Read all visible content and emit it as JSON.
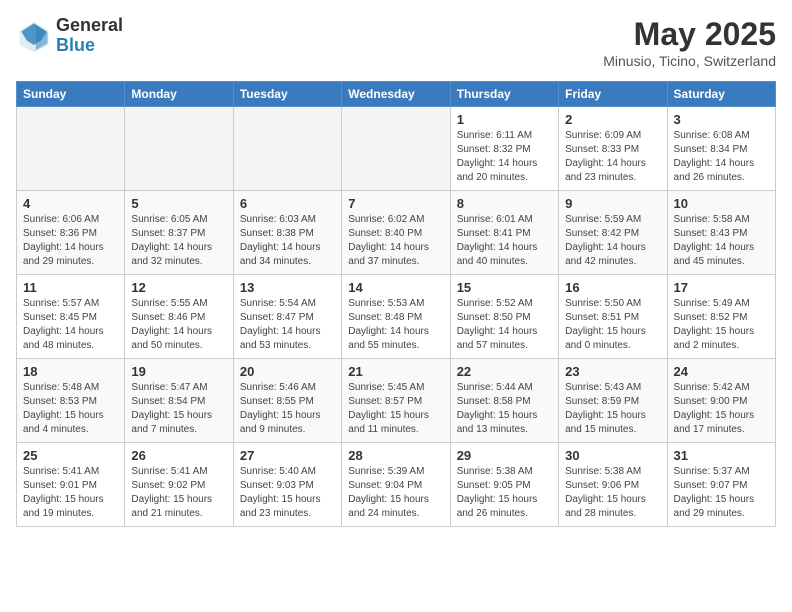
{
  "header": {
    "logo_general": "General",
    "logo_blue": "Blue",
    "month": "May 2025",
    "location": "Minusio, Ticino, Switzerland"
  },
  "days_of_week": [
    "Sunday",
    "Monday",
    "Tuesday",
    "Wednesday",
    "Thursday",
    "Friday",
    "Saturday"
  ],
  "weeks": [
    [
      {
        "day": "",
        "info": ""
      },
      {
        "day": "",
        "info": ""
      },
      {
        "day": "",
        "info": ""
      },
      {
        "day": "",
        "info": ""
      },
      {
        "day": "1",
        "info": "Sunrise: 6:11 AM\nSunset: 8:32 PM\nDaylight: 14 hours\nand 20 minutes."
      },
      {
        "day": "2",
        "info": "Sunrise: 6:09 AM\nSunset: 8:33 PM\nDaylight: 14 hours\nand 23 minutes."
      },
      {
        "day": "3",
        "info": "Sunrise: 6:08 AM\nSunset: 8:34 PM\nDaylight: 14 hours\nand 26 minutes."
      }
    ],
    [
      {
        "day": "4",
        "info": "Sunrise: 6:06 AM\nSunset: 8:36 PM\nDaylight: 14 hours\nand 29 minutes."
      },
      {
        "day": "5",
        "info": "Sunrise: 6:05 AM\nSunset: 8:37 PM\nDaylight: 14 hours\nand 32 minutes."
      },
      {
        "day": "6",
        "info": "Sunrise: 6:03 AM\nSunset: 8:38 PM\nDaylight: 14 hours\nand 34 minutes."
      },
      {
        "day": "7",
        "info": "Sunrise: 6:02 AM\nSunset: 8:40 PM\nDaylight: 14 hours\nand 37 minutes."
      },
      {
        "day": "8",
        "info": "Sunrise: 6:01 AM\nSunset: 8:41 PM\nDaylight: 14 hours\nand 40 minutes."
      },
      {
        "day": "9",
        "info": "Sunrise: 5:59 AM\nSunset: 8:42 PM\nDaylight: 14 hours\nand 42 minutes."
      },
      {
        "day": "10",
        "info": "Sunrise: 5:58 AM\nSunset: 8:43 PM\nDaylight: 14 hours\nand 45 minutes."
      }
    ],
    [
      {
        "day": "11",
        "info": "Sunrise: 5:57 AM\nSunset: 8:45 PM\nDaylight: 14 hours\nand 48 minutes."
      },
      {
        "day": "12",
        "info": "Sunrise: 5:55 AM\nSunset: 8:46 PM\nDaylight: 14 hours\nand 50 minutes."
      },
      {
        "day": "13",
        "info": "Sunrise: 5:54 AM\nSunset: 8:47 PM\nDaylight: 14 hours\nand 53 minutes."
      },
      {
        "day": "14",
        "info": "Sunrise: 5:53 AM\nSunset: 8:48 PM\nDaylight: 14 hours\nand 55 minutes."
      },
      {
        "day": "15",
        "info": "Sunrise: 5:52 AM\nSunset: 8:50 PM\nDaylight: 14 hours\nand 57 minutes."
      },
      {
        "day": "16",
        "info": "Sunrise: 5:50 AM\nSunset: 8:51 PM\nDaylight: 15 hours\nand 0 minutes."
      },
      {
        "day": "17",
        "info": "Sunrise: 5:49 AM\nSunset: 8:52 PM\nDaylight: 15 hours\nand 2 minutes."
      }
    ],
    [
      {
        "day": "18",
        "info": "Sunrise: 5:48 AM\nSunset: 8:53 PM\nDaylight: 15 hours\nand 4 minutes."
      },
      {
        "day": "19",
        "info": "Sunrise: 5:47 AM\nSunset: 8:54 PM\nDaylight: 15 hours\nand 7 minutes."
      },
      {
        "day": "20",
        "info": "Sunrise: 5:46 AM\nSunset: 8:55 PM\nDaylight: 15 hours\nand 9 minutes."
      },
      {
        "day": "21",
        "info": "Sunrise: 5:45 AM\nSunset: 8:57 PM\nDaylight: 15 hours\nand 11 minutes."
      },
      {
        "day": "22",
        "info": "Sunrise: 5:44 AM\nSunset: 8:58 PM\nDaylight: 15 hours\nand 13 minutes."
      },
      {
        "day": "23",
        "info": "Sunrise: 5:43 AM\nSunset: 8:59 PM\nDaylight: 15 hours\nand 15 minutes."
      },
      {
        "day": "24",
        "info": "Sunrise: 5:42 AM\nSunset: 9:00 PM\nDaylight: 15 hours\nand 17 minutes."
      }
    ],
    [
      {
        "day": "25",
        "info": "Sunrise: 5:41 AM\nSunset: 9:01 PM\nDaylight: 15 hours\nand 19 minutes."
      },
      {
        "day": "26",
        "info": "Sunrise: 5:41 AM\nSunset: 9:02 PM\nDaylight: 15 hours\nand 21 minutes."
      },
      {
        "day": "27",
        "info": "Sunrise: 5:40 AM\nSunset: 9:03 PM\nDaylight: 15 hours\nand 23 minutes."
      },
      {
        "day": "28",
        "info": "Sunrise: 5:39 AM\nSunset: 9:04 PM\nDaylight: 15 hours\nand 24 minutes."
      },
      {
        "day": "29",
        "info": "Sunrise: 5:38 AM\nSunset: 9:05 PM\nDaylight: 15 hours\nand 26 minutes."
      },
      {
        "day": "30",
        "info": "Sunrise: 5:38 AM\nSunset: 9:06 PM\nDaylight: 15 hours\nand 28 minutes."
      },
      {
        "day": "31",
        "info": "Sunrise: 5:37 AM\nSunset: 9:07 PM\nDaylight: 15 hours\nand 29 minutes."
      }
    ]
  ]
}
